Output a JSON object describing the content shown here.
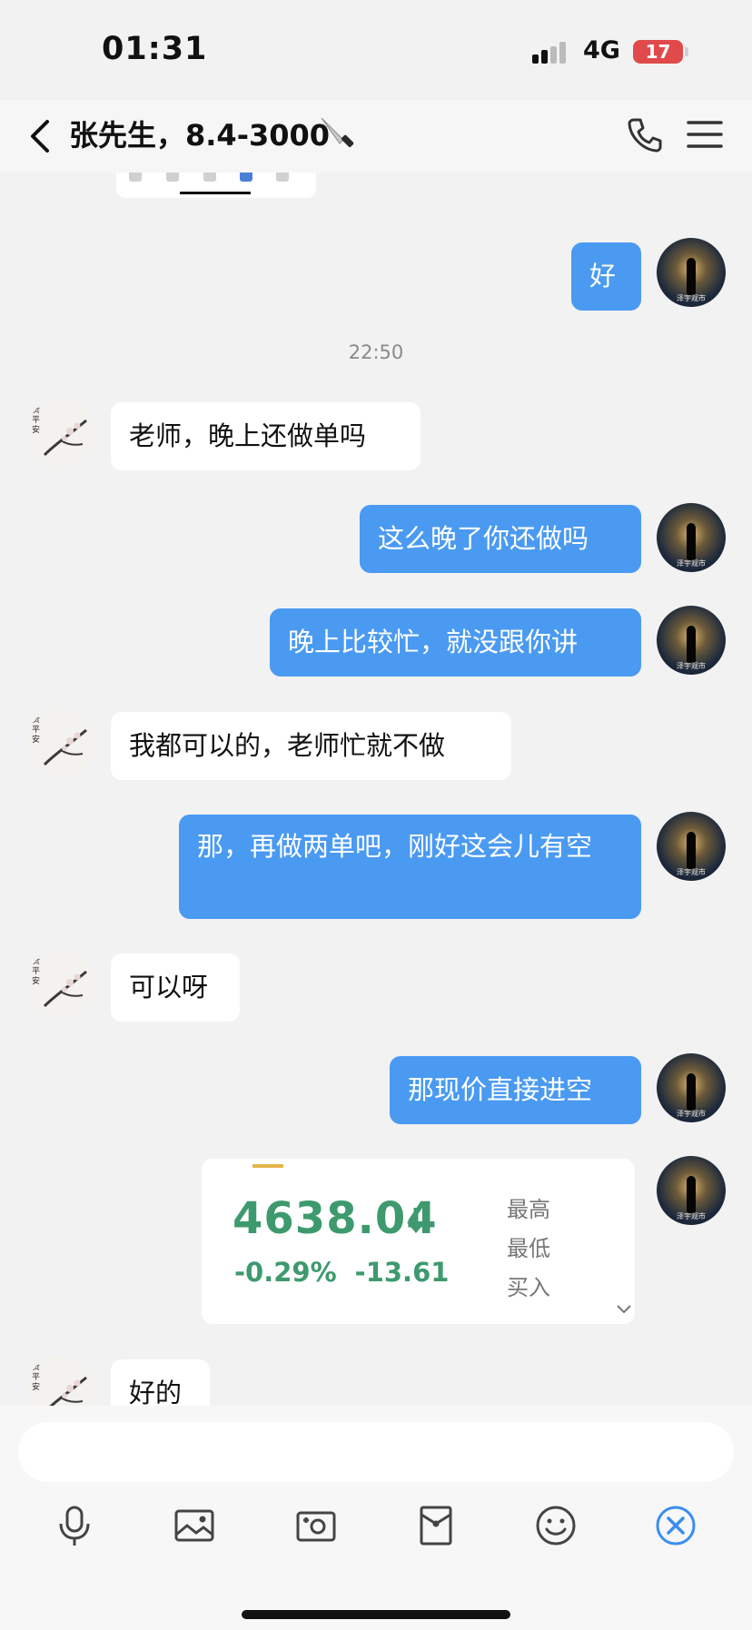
{
  "status_bar": {
    "time": "01:31",
    "network": "4G",
    "battery": "17"
  },
  "header": {
    "title": "张先生，8.4-3000"
  },
  "messages": [
    {
      "side": "right",
      "text": "好"
    },
    {
      "side": "left",
      "text": "老师，晚上还做单吗"
    },
    {
      "side": "right",
      "text": "这么晚了你还做吗"
    },
    {
      "side": "right",
      "text": "晚上比较忙，就没跟你讲"
    },
    {
      "side": "left",
      "text": "我都可以的，老师忙就不做"
    },
    {
      "side": "right",
      "text": "那，再做两单吧，刚好这会儿有空"
    },
    {
      "side": "left",
      "text": "可以呀"
    },
    {
      "side": "right",
      "text": "那现价直接进空"
    },
    {
      "side": "left",
      "text": "好的"
    }
  ],
  "timestamp": "22:50",
  "my_avatar_caption": "泽宇观市",
  "contact_avatar_text": "贵平安",
  "quote_card": {
    "price": "4638.04",
    "change_pct": "-0.29%",
    "change_abs": "-13.61",
    "labels": [
      "最高",
      "最低",
      "买入"
    ],
    "color": "#3e9a6e"
  },
  "toolbar_icons": [
    "microphone-icon",
    "image-icon",
    "camera-icon",
    "red-packet-icon",
    "emoji-icon",
    "close-icon"
  ],
  "colors": {
    "my_bubble": "#4a9af2",
    "their_bubble": "#ffffff",
    "background": "#f2f2f2"
  }
}
